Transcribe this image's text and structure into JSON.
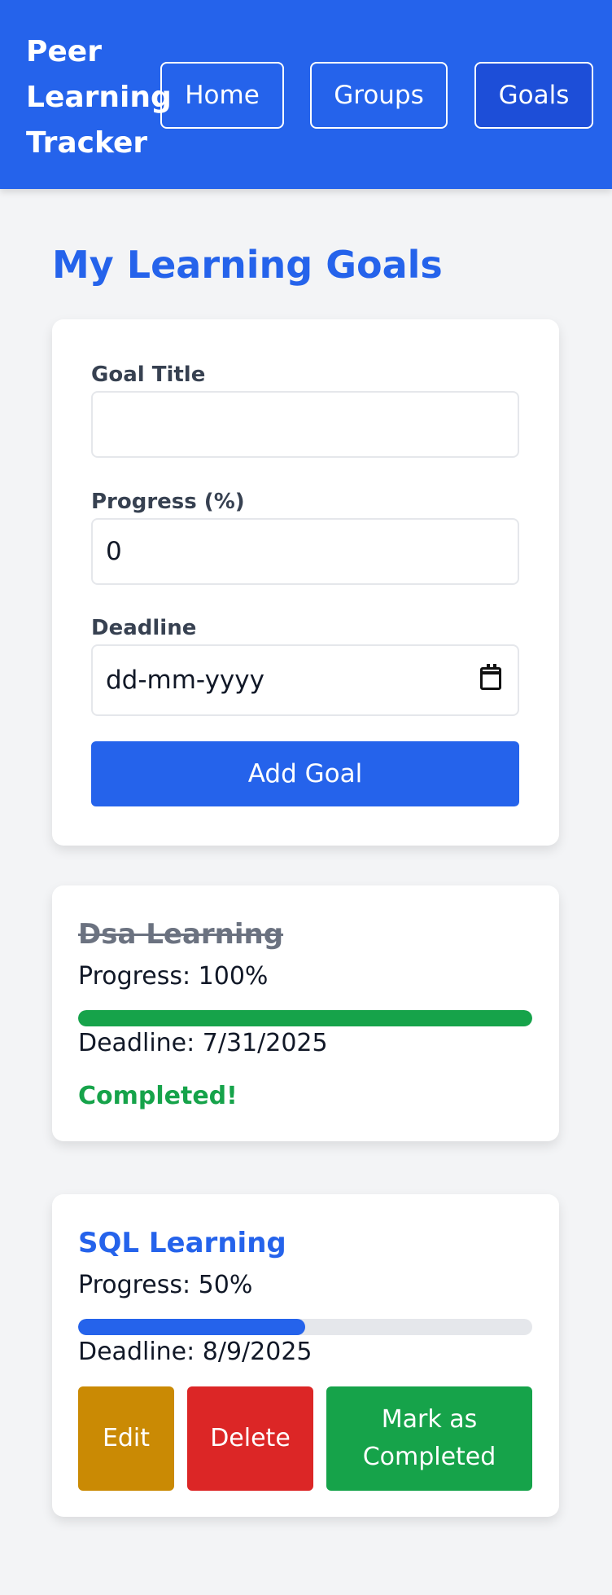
{
  "navbar": {
    "brand": "Peer Learning Tracker",
    "items": [
      {
        "label": "Home",
        "active": false
      },
      {
        "label": "Groups",
        "active": false
      },
      {
        "label": "Goals",
        "active": true
      }
    ]
  },
  "page": {
    "title": "My Learning Goals"
  },
  "form": {
    "title_label": "Goal Title",
    "title_value": "",
    "progress_label": "Progress (%)",
    "progress_value": "0",
    "deadline_label": "Deadline",
    "deadline_placeholder": "dd-mm-yyyy",
    "add_button": "Add Goal"
  },
  "goals": [
    {
      "title": "Dsa Learning",
      "progress_text": "Progress: 100%",
      "progress": 100,
      "deadline_text": "Deadline: 7/31/2025",
      "status": "Completed!",
      "completed": true,
      "bar_color": "#16a34a"
    },
    {
      "title": "SQL Learning",
      "progress_text": "Progress: 50%",
      "progress": 50,
      "deadline_text": "Deadline: 8/9/2025",
      "completed": false,
      "bar_color": "#2563eb",
      "actions": {
        "edit": "Edit",
        "delete": "Delete",
        "complete": "Mark as Completed"
      }
    }
  ],
  "colors": {
    "primary": "#2563eb",
    "success": "#16a34a",
    "warning": "#ca8a04",
    "danger": "#dc2626",
    "background": "#f3f4f6"
  }
}
